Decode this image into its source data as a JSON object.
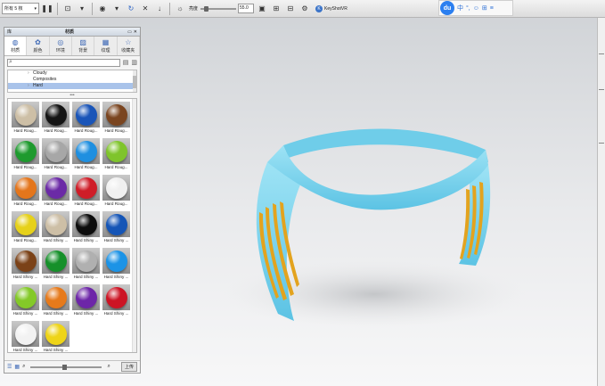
{
  "toolbar": {
    "render_mode": "所有 5 核",
    "brightness_label": "亮度",
    "brightness_value": "55.0",
    "keyshotvr_label": "KeyShotVR"
  },
  "ime": {
    "logo": "du",
    "items": [
      "中",
      "°,",
      "☺",
      "⊞",
      "≡"
    ]
  },
  "library": {
    "title": "材质",
    "left_title": "库",
    "tabs": [
      {
        "label": "材质",
        "icon": "material-icon"
      },
      {
        "label": "颜色",
        "icon": "color-icon"
      },
      {
        "label": "环境",
        "icon": "environment-icon"
      },
      {
        "label": "背景",
        "icon": "backplate-icon"
      },
      {
        "label": "纹理",
        "icon": "texture-icon"
      },
      {
        "label": "收藏夹",
        "icon": "favorites-icon"
      }
    ],
    "search_placeholder": "",
    "tree": [
      "Cloudy",
      "Composites",
      "Hard"
    ],
    "selected_tree_item": "Hard",
    "upload_label": "上传"
  },
  "materials": [
    {
      "label": "Hard Roug...",
      "color": "#cdbfa6"
    },
    {
      "label": "Hard Roug...",
      "color": "#151515"
    },
    {
      "label": "Hard Roug...",
      "color": "#1a55b8"
    },
    {
      "label": "Hard Roug...",
      "color": "#7a4520"
    },
    {
      "label": "Hard Roug...",
      "color": "#1e9a2e"
    },
    {
      "label": "Hard Roug...",
      "color": "#a7a7a7"
    },
    {
      "label": "Hard Roug...",
      "color": "#1f8fe0"
    },
    {
      "label": "Hard Roug...",
      "color": "#7fc42b"
    },
    {
      "label": "Hard Roug...",
      "color": "#e4761c"
    },
    {
      "label": "Hard Roug...",
      "color": "#6b2aa6"
    },
    {
      "label": "Hard Roug...",
      "color": "#cf1d28"
    },
    {
      "label": "Hard Roug...",
      "color": "#f0f0f0"
    },
    {
      "label": "Hard Roug...",
      "color": "#e6d11a"
    },
    {
      "label": "Hard Shiny ...",
      "color": "#cdbfa6"
    },
    {
      "label": "Hard Shiny ...",
      "color": "#0d0d0d"
    },
    {
      "label": "Hard Shiny ...",
      "color": "#1555b6"
    },
    {
      "label": "Hard Shiny ...",
      "color": "#7b4218"
    },
    {
      "label": "Hard Shiny ...",
      "color": "#16902a"
    },
    {
      "label": "Hard Shiny ...",
      "color": "#b0b0b0"
    },
    {
      "label": "Hard Shiny ...",
      "color": "#1c93e6"
    },
    {
      "label": "Hard Shiny ...",
      "color": "#84c928"
    },
    {
      "label": "Hard Shiny ...",
      "color": "#e67a1b"
    },
    {
      "label": "Hard Shiny ...",
      "color": "#6d26a8"
    },
    {
      "label": "Hard Shiny ...",
      "color": "#cc1424"
    },
    {
      "label": "Hard Shiny ...",
      "color": "#f2f2f2"
    },
    {
      "label": "Hard Shiny ...",
      "color": "#eed418"
    }
  ],
  "model_colors": {
    "body": "#7fd6ef",
    "stripes": "#e3a31e"
  }
}
